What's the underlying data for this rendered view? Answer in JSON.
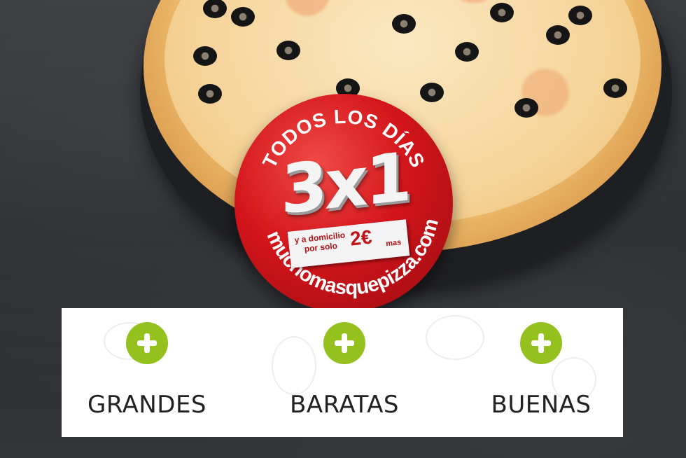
{
  "promo": {
    "top_text": "TODOS LOS DÍAS",
    "offer": "3x1",
    "delivery_text": "y a domicilio por solo",
    "price": "2€",
    "price_suffix": "mas",
    "website": "muchomasquepizza.com"
  },
  "features": [
    {
      "label": "GRANDES",
      "icon": "plus-circle-icon"
    },
    {
      "label": "BARATAS",
      "icon": "plus-circle-icon"
    },
    {
      "label": "BUENAS",
      "icon": "plus-circle-icon"
    }
  ],
  "colors": {
    "badge_red": "#d3151b",
    "icon_green": "#95c11f",
    "panel_bg": "#ffffff",
    "text_dark": "#222222"
  }
}
